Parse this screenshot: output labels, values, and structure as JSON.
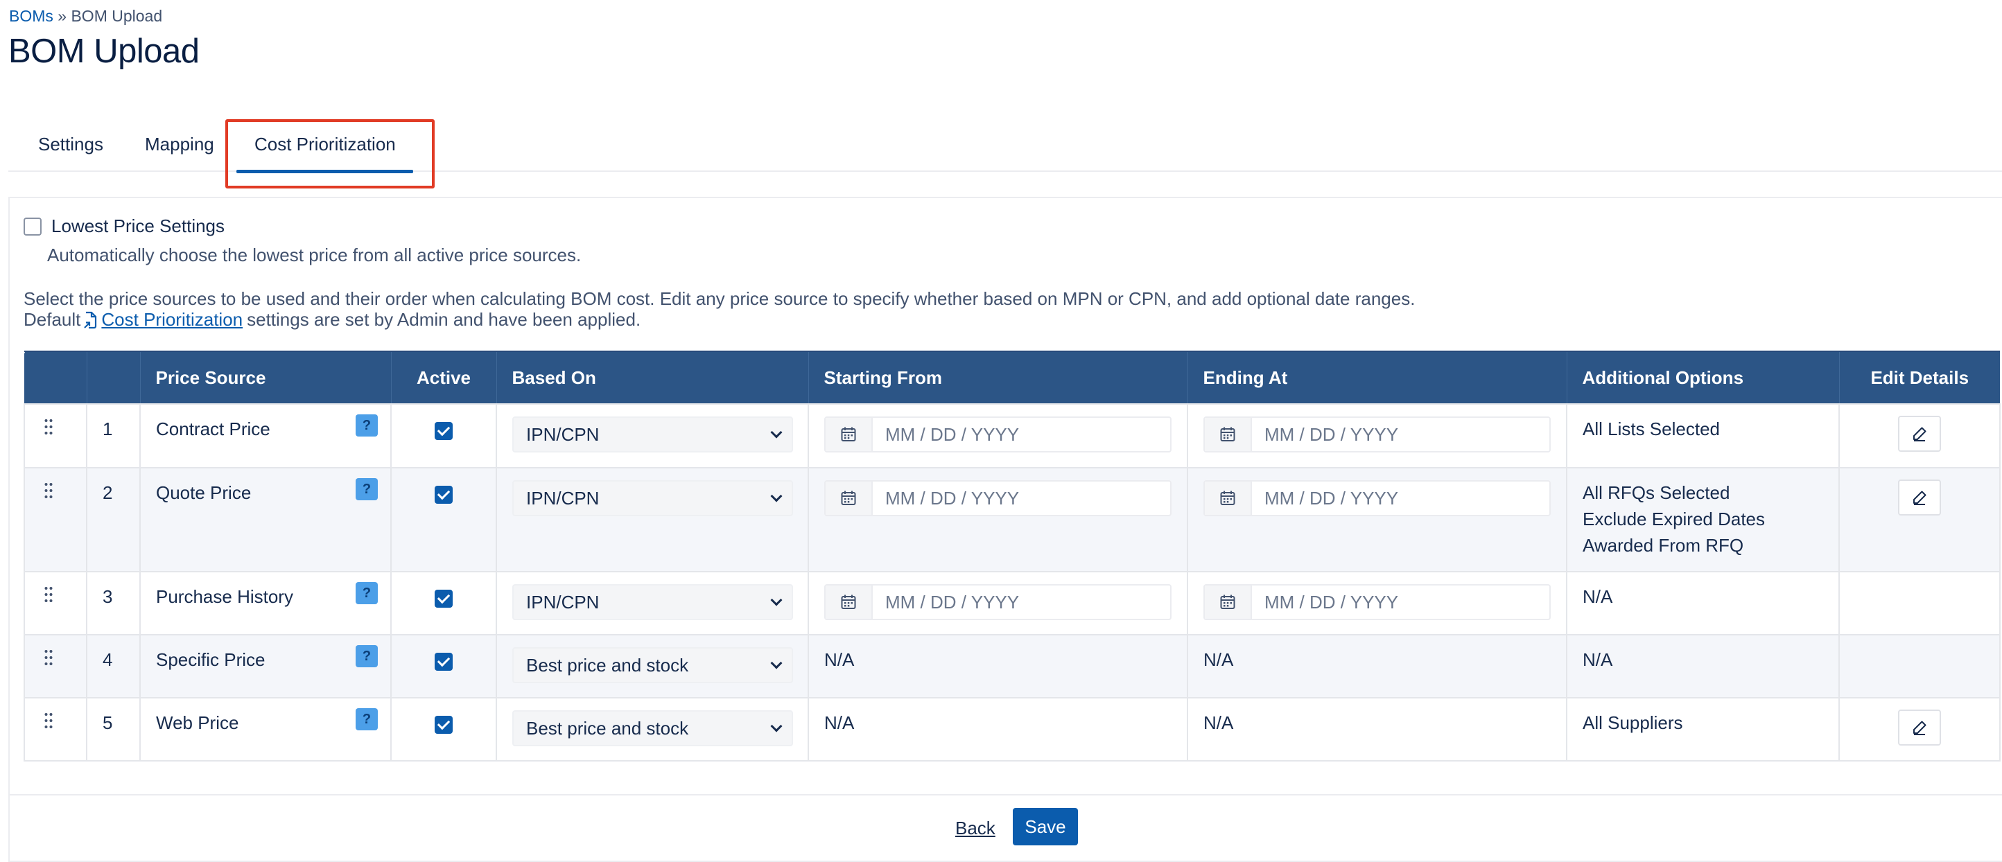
{
  "breadcrumb": {
    "root": "BOMs",
    "separator": "»",
    "current": "BOM Upload"
  },
  "page_title": "BOM Upload",
  "tabs": [
    {
      "label": "Settings",
      "active": false
    },
    {
      "label": "Mapping",
      "active": false
    },
    {
      "label": "Cost Prioritization",
      "active": true
    }
  ],
  "lowest_price": {
    "label": "Lowest Price Settings",
    "checked": false,
    "description": "Automatically choose the lowest price from all active price sources."
  },
  "info": {
    "line1": "Select the price sources to be used and their order when calculating BOM cost. Edit any price source to specify whether based on MPN or CPN, and add optional date ranges.",
    "prefix": "Default",
    "link": "Cost Prioritization",
    "suffix": "settings are set by Admin and have been applied."
  },
  "table": {
    "headers": [
      "",
      "",
      "Price Source",
      "Active",
      "Based On",
      "Starting From",
      "Ending At",
      "Additional Options",
      "Edit Details"
    ],
    "help_label": "?",
    "date_placeholder": "MM / DD / YYYY",
    "rows": [
      {
        "num": "1",
        "source": "Contract Price",
        "active": true,
        "based_on": "IPN/CPN",
        "start": "",
        "end": "",
        "options": [
          "All Lists Selected"
        ],
        "edit": true
      },
      {
        "num": "2",
        "source": "Quote Price",
        "active": true,
        "based_on": "IPN/CPN",
        "start": "",
        "end": "",
        "options": [
          "All RFQs Selected",
          "Exclude Expired Dates",
          "Awarded From RFQ"
        ],
        "edit": true
      },
      {
        "num": "3",
        "source": "Purchase History",
        "active": true,
        "based_on": "IPN/CPN",
        "start": "",
        "end": "",
        "options": [
          "N/A"
        ],
        "edit": false
      },
      {
        "num": "4",
        "source": "Specific Price",
        "active": true,
        "based_on": "Best price and stock",
        "start": "N/A",
        "end": "N/A",
        "options": [
          "N/A"
        ],
        "edit": false
      },
      {
        "num": "5",
        "source": "Web Price",
        "active": true,
        "based_on": "Best price and stock",
        "start": "N/A",
        "end": "N/A",
        "options": [
          "All Suppliers"
        ],
        "edit": true
      }
    ]
  },
  "buttons": {
    "back": "Back",
    "save": "Save"
  },
  "colors": {
    "header_bg": "#2c5586",
    "accent": "#0b5cad",
    "highlight": "#e13b25",
    "help_bg": "#4c9fe8"
  }
}
